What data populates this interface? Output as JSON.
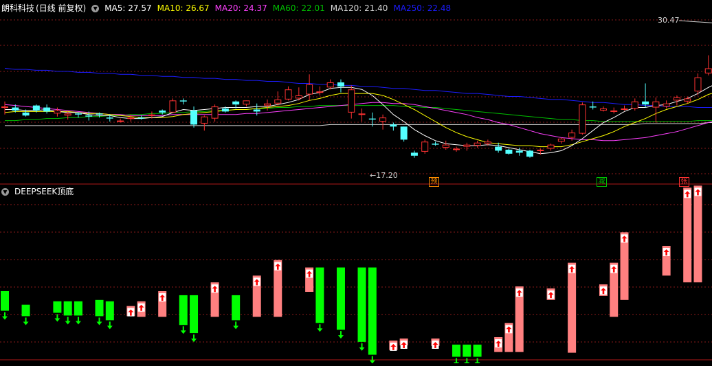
{
  "stock_name": "朗科科技",
  "period_label": "(日线 前复权)",
  "indicator_name": "DEEPSEEK顶底",
  "icons": {
    "toggle": "chevron-down-icon"
  },
  "colors": {
    "up": "#ff3232",
    "down": "#54ffff",
    "ma5": "#ffffff",
    "ma10": "#ffff00",
    "ma20": "#ff40ff",
    "ma60": "#00c000",
    "ma120": "#d8d8d8",
    "ma250": "#1c1cff",
    "bar_up": "#ff8080",
    "bar_down": "#00ff00"
  },
  "ma_legend": [
    {
      "label": "MA5: 27.57",
      "color": "#ffffff"
    },
    {
      "label": "MA10: 26.67",
      "color": "#ffff00"
    },
    {
      "label": "MA20: 24.37",
      "color": "#ff40ff"
    },
    {
      "label": "MA60: 22.01",
      "color": "#00c000"
    },
    {
      "label": "MA120: 21.40",
      "color": "#d8d8d8"
    },
    {
      "label": "MA250: 22.48",
      "color": "#1c1cff"
    }
  ],
  "annotations": {
    "high_label": "30.47",
    "low_label": "←17.20"
  },
  "markers": [
    {
      "text": "预",
      "color": "#ff8c00"
    },
    {
      "text": "减",
      "color": "#00c000"
    },
    {
      "text": "张",
      "color": "#ff3232"
    }
  ],
  "chart_data": [
    {
      "type": "candlestick",
      "title": "朗科科技 (日线 前复权)",
      "ylim": [
        15.8,
        31.8
      ],
      "ohlc": [
        [
          22.6,
          23.2,
          21.9,
          22.7
        ],
        [
          22.6,
          22.9,
          22.1,
          22.3
        ],
        [
          22.1,
          22.4,
          21.7,
          21.8
        ],
        [
          22.8,
          22.9,
          22.1,
          22.3
        ],
        [
          22.6,
          22.9,
          22.0,
          22.2
        ],
        [
          22.0,
          22.6,
          21.7,
          22.3
        ],
        [
          21.8,
          22.2,
          21.4,
          22.0
        ],
        [
          22.0,
          22.1,
          21.6,
          21.9
        ],
        [
          21.8,
          22.2,
          21.3,
          21.7
        ],
        [
          22.0,
          22.1,
          21.6,
          21.9
        ],
        [
          21.6,
          21.9,
          21.2,
          21.5
        ],
        [
          21.3,
          21.5,
          21.1,
          21.3
        ],
        [
          21.5,
          21.9,
          21.2,
          21.6
        ],
        [
          21.6,
          21.8,
          21.4,
          21.5
        ],
        [
          21.8,
          22.2,
          21.5,
          21.9
        ],
        [
          22.3,
          22.4,
          21.9,
          22.1
        ],
        [
          22.1,
          23.5,
          22.1,
          23.3
        ],
        [
          23.3,
          23.5,
          22.9,
          23.2
        ],
        [
          22.3,
          22.7,
          20.6,
          20.9
        ],
        [
          21.0,
          21.8,
          20.3,
          21.7
        ],
        [
          21.5,
          22.9,
          21.2,
          22.7
        ],
        [
          22.5,
          22.7,
          22.1,
          22.2
        ],
        [
          23.2,
          23.3,
          22.5,
          22.9
        ],
        [
          22.9,
          23.3,
          22.7,
          23.3
        ],
        [
          22.4,
          23.0,
          21.8,
          22.2
        ],
        [
          22.8,
          23.4,
          22.3,
          23.0
        ],
        [
          23.0,
          24.2,
          22.8,
          23.4
        ],
        [
          23.4,
          24.7,
          23.3,
          24.4
        ],
        [
          23.5,
          24.6,
          23.3,
          23.8
        ],
        [
          23.9,
          25.9,
          23.3,
          24.9
        ],
        [
          24.2,
          24.7,
          23.8,
          24.2
        ],
        [
          24.6,
          25.4,
          24.4,
          25.1
        ],
        [
          25.1,
          25.4,
          24.1,
          24.7
        ],
        [
          22.1,
          24.8,
          21.5,
          24.4
        ],
        [
          21.9,
          22.5,
          21.2,
          22.0
        ],
        [
          21.5,
          22.1,
          20.7,
          21.4
        ],
        [
          21.2,
          21.9,
          20.4,
          21.6
        ],
        [
          20.9,
          21.1,
          20.3,
          20.7
        ],
        [
          20.7,
          20.7,
          19.2,
          19.4
        ],
        [
          18.1,
          18.3,
          17.6,
          17.8
        ],
        [
          18.2,
          19.4,
          18.0,
          19.2
        ],
        [
          19.0,
          19.2,
          18.8,
          18.9
        ],
        [
          18.6,
          19.3,
          18.4,
          18.9
        ],
        [
          18.4,
          18.7,
          18.2,
          18.5
        ],
        [
          18.7,
          19.1,
          18.3,
          18.9
        ],
        [
          18.8,
          19.3,
          18.6,
          19.1
        ],
        [
          19.0,
          19.4,
          18.8,
          19.2
        ],
        [
          18.7,
          19.1,
          18.1,
          18.3
        ],
        [
          18.4,
          18.5,
          17.9,
          18.0
        ],
        [
          18.3,
          18.6,
          17.8,
          18.1
        ],
        [
          18.3,
          18.4,
          17.6,
          17.7
        ],
        [
          18.3,
          18.5,
          17.9,
          18.4
        ],
        [
          18.5,
          19.0,
          18.3,
          18.9
        ],
        [
          19.2,
          19.6,
          19.0,
          19.5
        ],
        [
          19.6,
          20.4,
          19.3,
          20.1
        ],
        [
          20.0,
          23.1,
          19.9,
          22.9
        ],
        [
          22.7,
          23.2,
          22.4,
          22.6
        ],
        [
          22.3,
          22.7,
          22.2,
          22.5
        ],
        [
          22.3,
          22.6,
          22.0,
          22.3
        ],
        [
          22.5,
          22.8,
          22.3,
          22.5
        ],
        [
          22.5,
          23.5,
          22.3,
          23.2
        ],
        [
          23.2,
          25.0,
          22.6,
          22.9
        ],
        [
          22.6,
          23.6,
          21.1,
          23.2
        ],
        [
          22.7,
          23.3,
          22.5,
          23.0
        ],
        [
          23.3,
          23.8,
          22.8,
          23.6
        ],
        [
          23.2,
          23.7,
          23.0,
          23.5
        ],
        [
          24.2,
          26.0,
          23.8,
          25.6
        ],
        [
          26.0,
          27.8,
          25.8,
          26.5
        ],
        [
          26.6,
          27.3,
          26.0,
          27.2
        ],
        [
          27.2,
          29.1,
          26.5,
          27.8
        ],
        [
          27.8,
          28.3,
          26.8,
          27.0
        ],
        [
          27.2,
          27.4,
          27.1,
          27.3
        ],
        [
          27.0,
          28.1,
          26.7,
          27.7
        ],
        [
          27.3,
          27.6,
          26.7,
          27.4
        ],
        [
          27.0,
          27.7,
          26.5,
          27.6
        ],
        [
          27.6,
          29.1,
          26.8,
          26.5
        ],
        [
          26.6,
          30.47,
          25.0,
          30.4
        ],
        [
          29.7,
          30.1,
          28.8,
          28.8
        ],
        [
          28.8,
          29.6,
          28.2,
          29.2
        ]
      ],
      "ma5": [
        22.4,
        22.4,
        22.3,
        22.3,
        22.4,
        22.2,
        22.1,
        22.1,
        21.9,
        21.8,
        21.8,
        21.6,
        21.5,
        21.5,
        21.6,
        21.7,
        22.1,
        22.4,
        22.3,
        22.4,
        22.5,
        22.6,
        22.6,
        22.6,
        22.7,
        22.7,
        22.9,
        23.1,
        23.4,
        23.9,
        24.1,
        24.5,
        24.6,
        24.6,
        24.4,
        23.8,
        22.9,
        21.9,
        21.2,
        20.4,
        19.8,
        19.3,
        19.0,
        18.9,
        18.8,
        18.8,
        18.9,
        18.8,
        18.6,
        18.4,
        18.2,
        18.0,
        18.1,
        18.3,
        18.8,
        19.5,
        20.3,
        21.1,
        21.6,
        22.2,
        22.6,
        22.6,
        22.8,
        22.9,
        23.2,
        23.5,
        24.0,
        24.6,
        25.1,
        25.7,
        26.4,
        26.9,
        27.3,
        27.4,
        27.4,
        27.5,
        27.6,
        27.6,
        27.6
      ],
      "ma10": [
        22.1,
        22.2,
        22.2,
        22.2,
        22.2,
        22.2,
        22.2,
        22.1,
        22.0,
        22.0,
        21.9,
        21.8,
        21.7,
        21.6,
        21.6,
        21.6,
        21.7,
        21.9,
        22.0,
        22.1,
        22.2,
        22.3,
        22.4,
        22.4,
        22.5,
        22.6,
        22.7,
        22.8,
        23.0,
        23.3,
        23.5,
        23.8,
        24.0,
        24.0,
        24.0,
        24.0,
        23.8,
        23.4,
        22.9,
        22.4,
        21.8,
        21.2,
        20.6,
        20.1,
        19.7,
        19.4,
        19.1,
        19.0,
        18.9,
        18.8,
        18.8,
        18.7,
        18.7,
        18.7,
        18.9,
        19.2,
        19.5,
        19.8,
        20.2,
        20.7,
        21.1,
        21.5,
        22.0,
        22.4,
        22.7,
        23.0,
        23.4,
        23.9,
        24.2,
        24.6,
        25.0,
        25.4,
        25.8,
        26.0,
        26.3,
        26.5,
        26.6,
        26.6,
        26.7
      ],
      "ma20": [
        22.9,
        22.8,
        22.7,
        22.6,
        22.5,
        22.4,
        22.3,
        22.2,
        22.1,
        22.0,
        21.9,
        21.9,
        21.8,
        21.8,
        21.8,
        21.8,
        21.9,
        21.9,
        21.9,
        21.9,
        21.9,
        21.9,
        21.9,
        22.0,
        22.0,
        22.1,
        22.2,
        22.3,
        22.4,
        22.5,
        22.6,
        22.7,
        22.8,
        22.9,
        23.0,
        23.1,
        23.1,
        23.0,
        23.0,
        22.9,
        22.7,
        22.5,
        22.3,
        22.1,
        21.9,
        21.6,
        21.4,
        21.1,
        20.9,
        20.6,
        20.3,
        20.0,
        19.8,
        19.6,
        19.5,
        19.4,
        19.4,
        19.3,
        19.3,
        19.4,
        19.5,
        19.6,
        19.8,
        20.0,
        20.2,
        20.5,
        20.8,
        21.1,
        21.4,
        21.8,
        22.2,
        22.5,
        22.9,
        23.2,
        23.5,
        23.8,
        24.0,
        24.2,
        24.37
      ],
      "ma60": [
        21.3,
        21.3,
        21.4,
        21.4,
        21.5,
        21.5,
        21.6,
        21.6,
        21.7,
        21.7,
        21.8,
        21.8,
        21.9,
        21.9,
        22.0,
        22.0,
        22.1,
        22.1,
        22.2,
        22.2,
        22.3,
        22.3,
        22.4,
        22.4,
        22.5,
        22.5,
        22.6,
        22.6,
        22.7,
        22.7,
        22.8,
        22.8,
        22.8,
        22.8,
        22.8,
        22.8,
        22.8,
        22.8,
        22.7,
        22.7,
        22.6,
        22.6,
        22.5,
        22.4,
        22.3,
        22.2,
        22.1,
        22.0,
        21.9,
        21.8,
        21.7,
        21.6,
        21.5,
        21.4,
        21.4,
        21.3,
        21.3,
        21.2,
        21.2,
        21.2,
        21.2,
        21.2,
        21.2,
        21.2,
        21.2,
        21.2,
        21.3,
        21.3,
        21.3,
        21.4,
        21.4,
        21.5,
        21.6,
        21.6,
        21.7,
        21.8,
        21.8,
        21.9,
        22.0
      ],
      "ma120": [
        20.8,
        20.8,
        20.8,
        20.8,
        20.8,
        20.8,
        20.8,
        20.8,
        20.8,
        20.8,
        20.8,
        20.8,
        20.8,
        20.8,
        20.8,
        20.8,
        20.8,
        20.8,
        20.8,
        20.8,
        20.8,
        20.8,
        20.8,
        20.8,
        20.8,
        20.8,
        20.8,
        20.8,
        20.8,
        20.8,
        20.8,
        20.9,
        20.9,
        20.9,
        20.9,
        20.9,
        20.9,
        20.9,
        20.9,
        20.9,
        20.9,
        20.9,
        20.9,
        20.9,
        20.9,
        20.9,
        20.9,
        20.9,
        20.9,
        20.9,
        20.9,
        20.9,
        20.9,
        20.9,
        20.9,
        20.9,
        20.9,
        20.9,
        20.9,
        20.9,
        20.9,
        21.0,
        21.0,
        21.0,
        21.0,
        21.0,
        21.0,
        21.1,
        21.1,
        21.1,
        21.1,
        21.1,
        21.2,
        21.2,
        21.2,
        21.3,
        21.3,
        21.3,
        21.4
      ],
      "ma250": [
        26.5,
        26.4,
        26.4,
        26.3,
        26.3,
        26.2,
        26.2,
        26.1,
        26.1,
        26.0,
        26.0,
        25.9,
        25.9,
        25.8,
        25.8,
        25.7,
        25.7,
        25.6,
        25.6,
        25.5,
        25.5,
        25.4,
        25.4,
        25.3,
        25.3,
        25.2,
        25.2,
        25.1,
        25.0,
        25.0,
        24.9,
        24.9,
        24.8,
        24.8,
        24.7,
        24.7,
        24.6,
        24.5,
        24.5,
        24.4,
        24.3,
        24.3,
        24.2,
        24.1,
        24.0,
        24.0,
        23.9,
        23.8,
        23.7,
        23.7,
        23.6,
        23.5,
        23.4,
        23.4,
        23.3,
        23.2,
        23.1,
        23.1,
        23.0,
        22.9,
        22.9,
        22.8,
        22.8,
        22.7,
        22.7,
        22.7,
        22.6,
        22.6,
        22.6,
        22.6,
        22.5,
        22.5,
        22.5,
        22.5,
        22.5,
        22.5,
        22.5,
        22.5,
        22.48
      ],
      "high_annotation": {
        "value": 30.47,
        "bar_index": 76
      },
      "low_annotation": {
        "value": 17.2,
        "bar_index": 39
      }
    },
    {
      "type": "bar",
      "title": "DEEPSEEK顶底",
      "ylim": [
        -10,
        10
      ],
      "bars": [
        {
          "i": 0,
          "from": -6.2,
          "to": -3.3,
          "signal": "down"
        },
        {
          "i": 2,
          "from": -7.0,
          "to": -5.3,
          "signal": "down"
        },
        {
          "i": 5,
          "from": -6.5,
          "to": -4.8,
          "signal": "down"
        },
        {
          "i": 6,
          "from": -6.9,
          "to": -4.8,
          "signal": "down"
        },
        {
          "i": 7,
          "from": -6.9,
          "to": -4.8,
          "signal": "down"
        },
        {
          "i": 9,
          "from": -7.0,
          "to": -4.6,
          "signal": "down"
        },
        {
          "i": 10,
          "from": -7.6,
          "to": -4.8,
          "signal": "down"
        },
        {
          "i": 12,
          "from": -7.0,
          "to": -5.5,
          "signal": "up"
        },
        {
          "i": 13,
          "from": -7.1,
          "to": -4.8,
          "signal": "up"
        },
        {
          "i": 15,
          "from": -7.1,
          "to": -3.3,
          "signal": "up"
        },
        {
          "i": 17,
          "from": -8.3,
          "to": -3.9,
          "signal": "down"
        },
        {
          "i": 18,
          "from": -9.5,
          "to": -3.9,
          "signal": "down"
        },
        {
          "i": 20,
          "from": -7.1,
          "to": -2.0,
          "signal": "up"
        },
        {
          "i": 22,
          "from": -7.6,
          "to": -3.9,
          "signal": "down"
        },
        {
          "i": 24,
          "from": -7.1,
          "to": -1.0,
          "signal": "up"
        },
        {
          "i": 26,
          "from": -7.1,
          "to": 1.3,
          "signal": "up"
        },
        {
          "i": 29,
          "from": -3.4,
          "to": 0.2,
          "signal": "up"
        },
        {
          "i": 30,
          "from": -8.0,
          "to": 0.2,
          "signal": "down"
        },
        {
          "i": 32,
          "from": -9.0,
          "to": 0.2,
          "signal": "down"
        },
        {
          "i": 34,
          "from": -10.8,
          "to": 0.2,
          "signal": "down"
        },
        {
          "i": 35,
          "from": -12.7,
          "to": 0.2,
          "signal": "down"
        },
        {
          "i": 37,
          "from": -12.0,
          "to": -10.6,
          "signal": "up"
        },
        {
          "i": 38,
          "from": -11.3,
          "to": -10.3,
          "signal": "up"
        },
        {
          "i": 41,
          "from": -11.4,
          "to": -10.3,
          "signal": "up"
        },
        {
          "i": 43,
          "from": -13.0,
          "to": -11.2,
          "signal": "down"
        },
        {
          "i": 44,
          "from": -13.0,
          "to": -11.2,
          "signal": "down"
        },
        {
          "i": 45,
          "from": -13.0,
          "to": -11.2,
          "signal": "down"
        },
        {
          "i": 47,
          "from": -12.3,
          "to": -10.1,
          "signal": "up"
        },
        {
          "i": 48,
          "from": -12.3,
          "to": -8.0,
          "signal": "up"
        },
        {
          "i": 49,
          "from": -12.3,
          "to": -2.6,
          "signal": "up"
        },
        {
          "i": 52,
          "from": -4.6,
          "to": -2.9,
          "signal": "up"
        },
        {
          "i": 54,
          "from": -12.4,
          "to": 0.9,
          "signal": "up"
        },
        {
          "i": 57,
          "from": -4.0,
          "to": -2.3,
          "signal": "up"
        },
        {
          "i": 58,
          "from": -7.1,
          "to": 0.9,
          "signal": "up"
        },
        {
          "i": 59,
          "from": -4.6,
          "to": 5.4,
          "signal": "up"
        },
        {
          "i": 63,
          "from": -1.0,
          "to": 3.4,
          "signal": "up"
        },
        {
          "i": 65,
          "from": -2.0,
          "to": 12.0,
          "signal": "up"
        },
        {
          "i": 66,
          "from": -2.0,
          "to": 12.3,
          "signal": "up"
        }
      ]
    }
  ]
}
